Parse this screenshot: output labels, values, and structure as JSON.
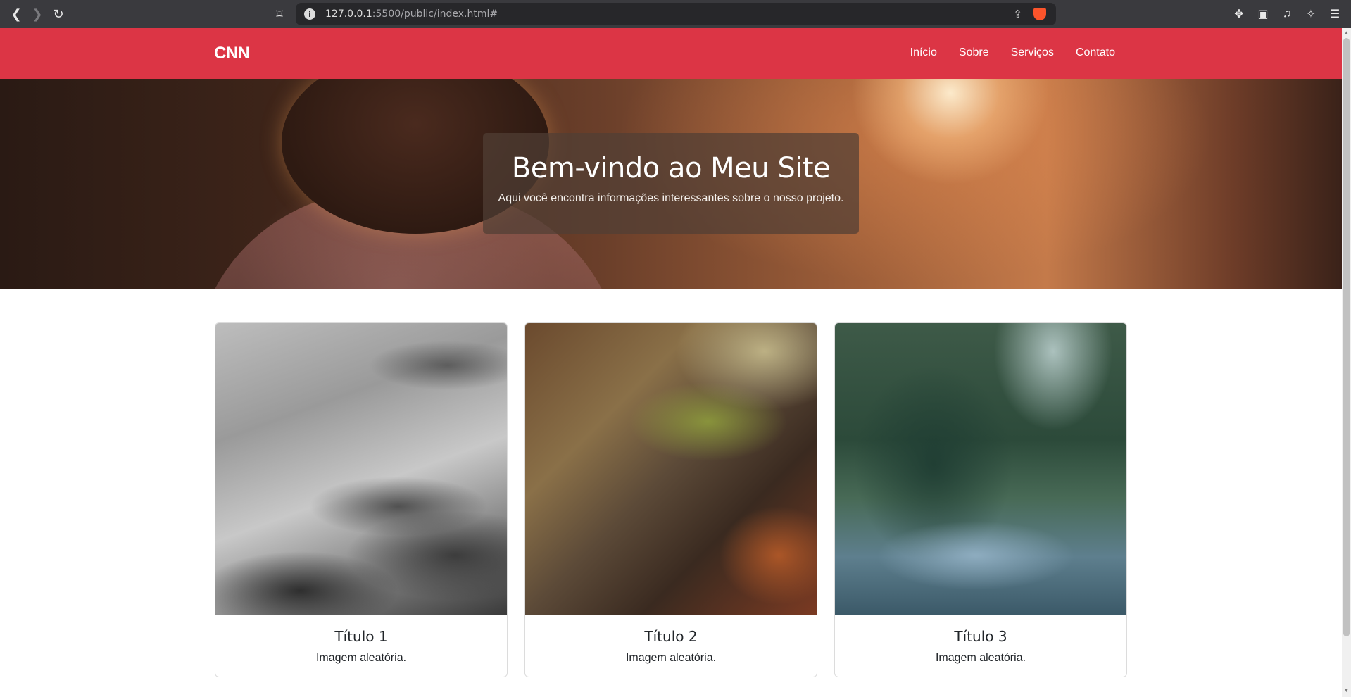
{
  "browser": {
    "url_host": "127.0.0.1",
    "url_path": ":5500/public/index.html#",
    "info_glyph": "i",
    "back_glyph": "❮",
    "forward_glyph": "❯",
    "reload_glyph": "↻",
    "bookmark_glyph": "⌑",
    "share_glyph": "⇪",
    "right_icons": [
      "puzzle-icon",
      "wallet-icon",
      "music-icon",
      "leo-icon",
      "menu-icon"
    ],
    "right_glyphs": [
      "✥",
      "▣",
      "♫",
      "✧",
      "☰"
    ]
  },
  "navbar": {
    "brand": "CNN",
    "links": [
      "Início",
      "Sobre",
      "Serviços",
      "Contato"
    ],
    "background": "#dc3545"
  },
  "hero": {
    "title": "Bem-vindo ao Meu Site",
    "subtitle": "Aqui você encontra informações interessantes sobre o nosso projeto."
  },
  "cards": [
    {
      "title": "Título 1",
      "text": "Imagem aleatória."
    },
    {
      "title": "Título 2",
      "text": "Imagem aleatória."
    },
    {
      "title": "Título 3",
      "text": "Imagem aleatória."
    }
  ]
}
